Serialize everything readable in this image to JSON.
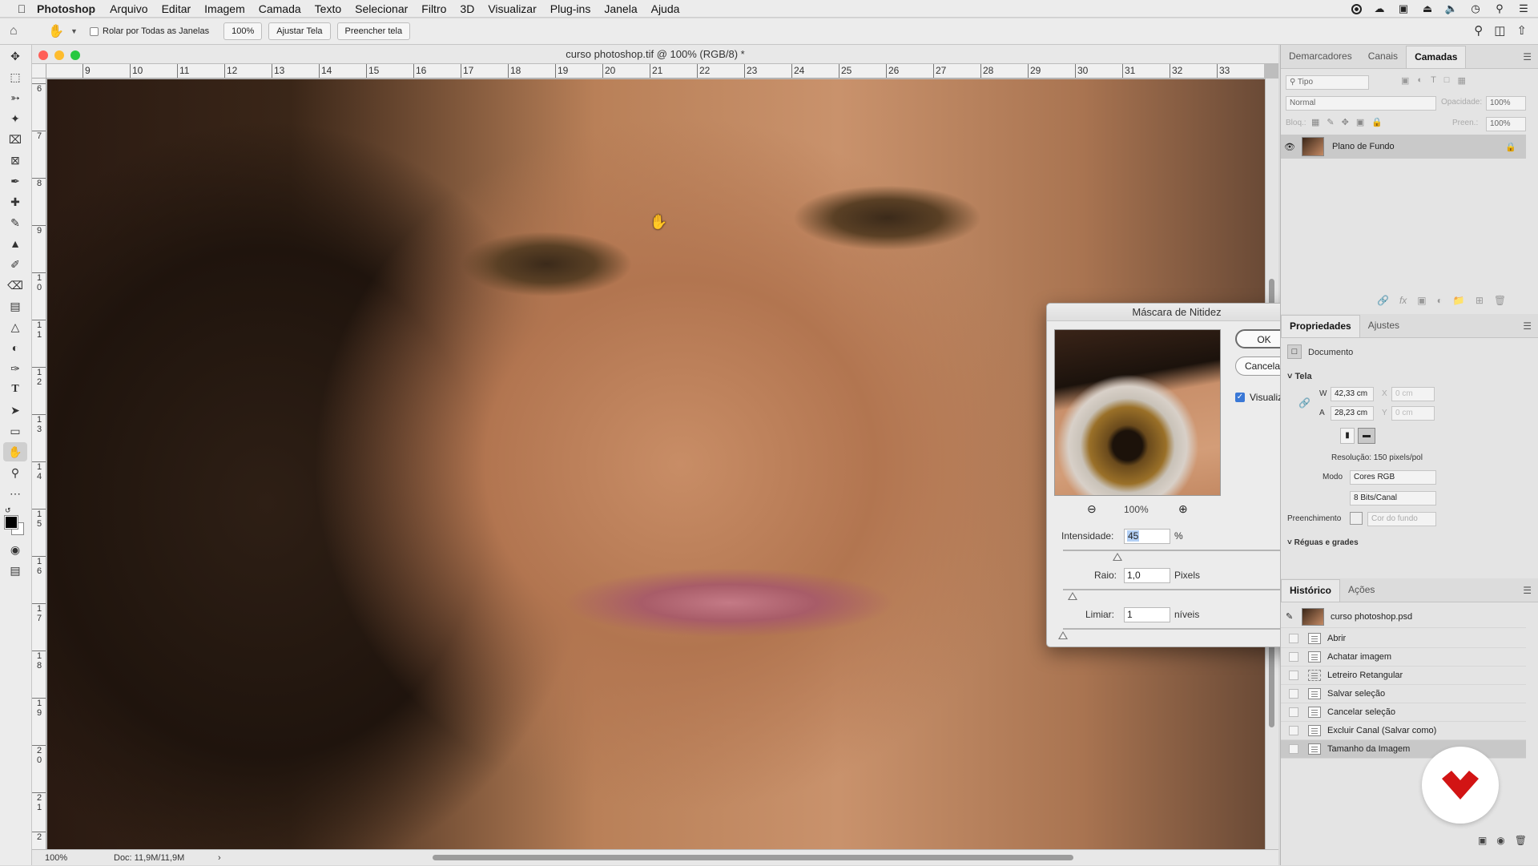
{
  "menubar": {
    "app_name": "Photoshop",
    "items": [
      "Arquivo",
      "Editar",
      "Imagem",
      "Camada",
      "Texto",
      "Selecionar",
      "Filtro",
      "3D",
      "Visualizar",
      "Plug-ins",
      "Janela",
      "Ajuda"
    ]
  },
  "options": {
    "scroll_all_label": "Rolar por Todas as Janelas",
    "zoom_value": "100%",
    "fit_screen": "Ajustar Tela",
    "fill_screen": "Preencher tela"
  },
  "document": {
    "title": "curso photoshop.tif @ 100% (RGB/8) *",
    "ruler_h": [
      "9",
      "10",
      "11",
      "12",
      "13",
      "14",
      "15",
      "16",
      "17",
      "18",
      "19",
      "20",
      "21",
      "22",
      "23",
      "24",
      "25",
      "26",
      "27",
      "28",
      "29",
      "30",
      "31",
      "32",
      "33"
    ],
    "ruler_v": [
      "6",
      "7",
      "8",
      "9",
      "1\n0",
      "1\n1",
      "1\n2",
      "1\n3",
      "1\n4",
      "1\n5",
      "1\n6",
      "1\n7",
      "1\n8",
      "1\n9",
      "2\n0",
      "2\n1",
      "2"
    ],
    "status_zoom": "100%",
    "status_doc": "Doc: 11,9M/11,9M"
  },
  "layers_panel": {
    "tabs": [
      "Demarcadores",
      "Canais",
      "Camadas"
    ],
    "filter_placeholder": "Tipo",
    "blend_mode": "Normal",
    "opacity_label": "Opacidade:",
    "opacity_value": "100%",
    "lock_label": "Bloq.:",
    "fill_label": "Preen.:",
    "fill_value": "100%",
    "layer_name": "Plano de Fundo"
  },
  "properties": {
    "tabs": [
      "Propriedades",
      "Ajustes"
    ],
    "doc_label": "Documento",
    "section_canvas": "Tela",
    "w_label": "W",
    "w_value": "42,33 cm",
    "h_label": "A",
    "h_value": "28,23 cm",
    "x_label": "X",
    "x_value": "0 cm",
    "y_label": "Y",
    "y_value": "0 cm",
    "resolution": "Resolução: 150 pixels/pol",
    "mode_label": "Modo",
    "mode_value": "Cores RGB",
    "bits_value": "8 Bits/Canal",
    "fill_label": "Preenchimento",
    "fill_value": "Cor do fundo",
    "section_rulers": "Réguas e grades"
  },
  "history": {
    "tabs": [
      "Histórico",
      "Ações"
    ],
    "snapshot": "curso photoshop.psd",
    "items": [
      "Abrir",
      "Achatar imagem",
      "Letreiro Retangular",
      "Salvar seleção",
      "Cancelar seleção",
      "Excluir Canal (Salvar como)",
      "Tamanho da Imagem"
    ]
  },
  "dialog": {
    "title": "Máscara de Nitidez",
    "ok": "OK",
    "cancel": "Cancelar",
    "preview_label": "Visualizar",
    "zoom": "100%",
    "amount_label": "Intensidade:",
    "amount_value": "45",
    "amount_unit": "%",
    "radius_label": "Raio:",
    "radius_value": "1,0",
    "radius_unit": "Pixels",
    "threshold_label": "Limiar:",
    "threshold_value": "1",
    "threshold_unit": "níveis"
  },
  "colors": {
    "accent": "#3a78d6",
    "watermark": "#d21414"
  }
}
